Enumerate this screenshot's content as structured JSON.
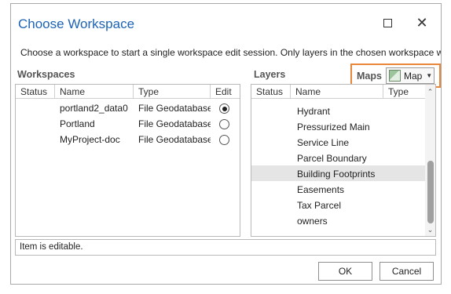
{
  "window": {
    "title": "Choose Workspace",
    "maximize_icon": "maximize-icon",
    "close_icon": "close-icon",
    "close_glyph": "✕"
  },
  "description": "Choose a workspace to start a single workspace edit session. Only layers in the chosen workspace will be editable.",
  "workspaces": {
    "label": "Workspaces",
    "columns": [
      "Status",
      "Name",
      "Type",
      "Edit"
    ],
    "rows": [
      {
        "status": "",
        "name": "portland2_data0",
        "type": "File Geodatabase",
        "edit": true
      },
      {
        "status": "",
        "name": "Portland",
        "type": "File Geodatabase",
        "edit": false
      },
      {
        "status": "",
        "name": "MyProject-doc",
        "type": "File Geodatabase",
        "edit": false
      }
    ]
  },
  "layers": {
    "label": "Layers",
    "maps_label": "Maps",
    "map_selected": "Map",
    "columns": [
      "Status",
      "Name",
      "Type"
    ],
    "selected_index": 4,
    "rows": [
      {
        "status": "",
        "name": "Hydrant",
        "type": ""
      },
      {
        "status": "",
        "name": "Pressurized Main",
        "type": ""
      },
      {
        "status": "",
        "name": "Service Line",
        "type": ""
      },
      {
        "status": "",
        "name": "Parcel Boundary",
        "type": ""
      },
      {
        "status": "",
        "name": "Building Footprints",
        "type": ""
      },
      {
        "status": "",
        "name": "Easements",
        "type": ""
      },
      {
        "status": "",
        "name": "Tax Parcel",
        "type": ""
      },
      {
        "status": "",
        "name": "owners",
        "type": ""
      }
    ]
  },
  "status_text": "Item is editable.",
  "buttons": {
    "ok": "OK",
    "cancel": "Cancel"
  }
}
